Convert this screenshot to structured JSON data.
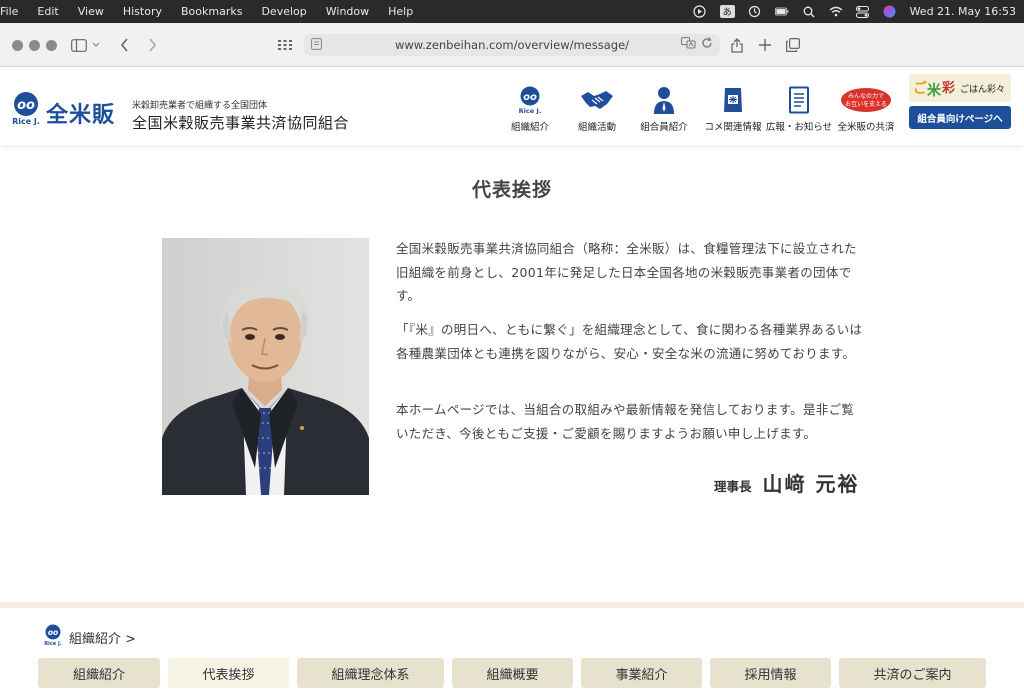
{
  "menubar": {
    "items": [
      "File",
      "Edit",
      "View",
      "History",
      "Bookmarks",
      "Develop",
      "Window",
      "Help"
    ],
    "input_mode": "あ",
    "datetime": "Wed 21. May  16:53"
  },
  "browser": {
    "url": "www.zenbeihan.com/overview/message/"
  },
  "header": {
    "logo_text": "Rice J.",
    "brand": "全米販",
    "tagline": "米穀卸売業者で組織する全国団体",
    "org_name": "全国米穀販売事業共済協同組合",
    "nav": [
      {
        "label": "組織紹介",
        "icon": "rice-j-logo-icon"
      },
      {
        "label": "組織活動",
        "icon": "handshake-icon"
      },
      {
        "label": "組合員紹介",
        "icon": "person-icon"
      },
      {
        "label": "コメ関連情報",
        "icon": "rice-bag-icon"
      },
      {
        "label": "広報・お知らせ",
        "icon": "document-icon"
      },
      {
        "label": "全米販の共済",
        "icon": "mutual-aid-badge-icon"
      }
    ],
    "mutual_badge": "みんなの力で\nお互いを支える",
    "gohan_label": "ごはん彩々",
    "member_button": "組合員向けページへ"
  },
  "main": {
    "title": "代表挨拶",
    "paragraphs": [
      "全国米穀販売事業共済協同組合（略称：全米販）は、食糧管理法下に設立された旧組織を前身とし、2001年に発足した日本全国各地の米穀販売事業者の団体です。",
      "「『米』の明日へ、ともに繋ぐ」を組織理念として、食に関わる各種業界あるいは各種農業団体とも連携を図りながら、安心・安全な米の流通に努めております。",
      "本ホームページでは、当組合の取組みや最新情報を発信しております。是非ご覧いただき、今後ともご支援・ご愛顧を賜りますようお願い申し上げます。"
    ],
    "signature_title": "理事長",
    "signature_name": "山﨑 元裕"
  },
  "footer": {
    "section_label": "組織紹介 >",
    "tabs": [
      "組織紹介",
      "代表挨拶",
      "組織理念体系",
      "組織概要",
      "事業紹介",
      "採用情報",
      "共済のご案内"
    ],
    "active_tab": 1
  },
  "colors": {
    "brand_blue": "#1f4f9a",
    "tab_bg": "#e7e2cd",
    "tab_active_bg": "#f7f4e6"
  }
}
